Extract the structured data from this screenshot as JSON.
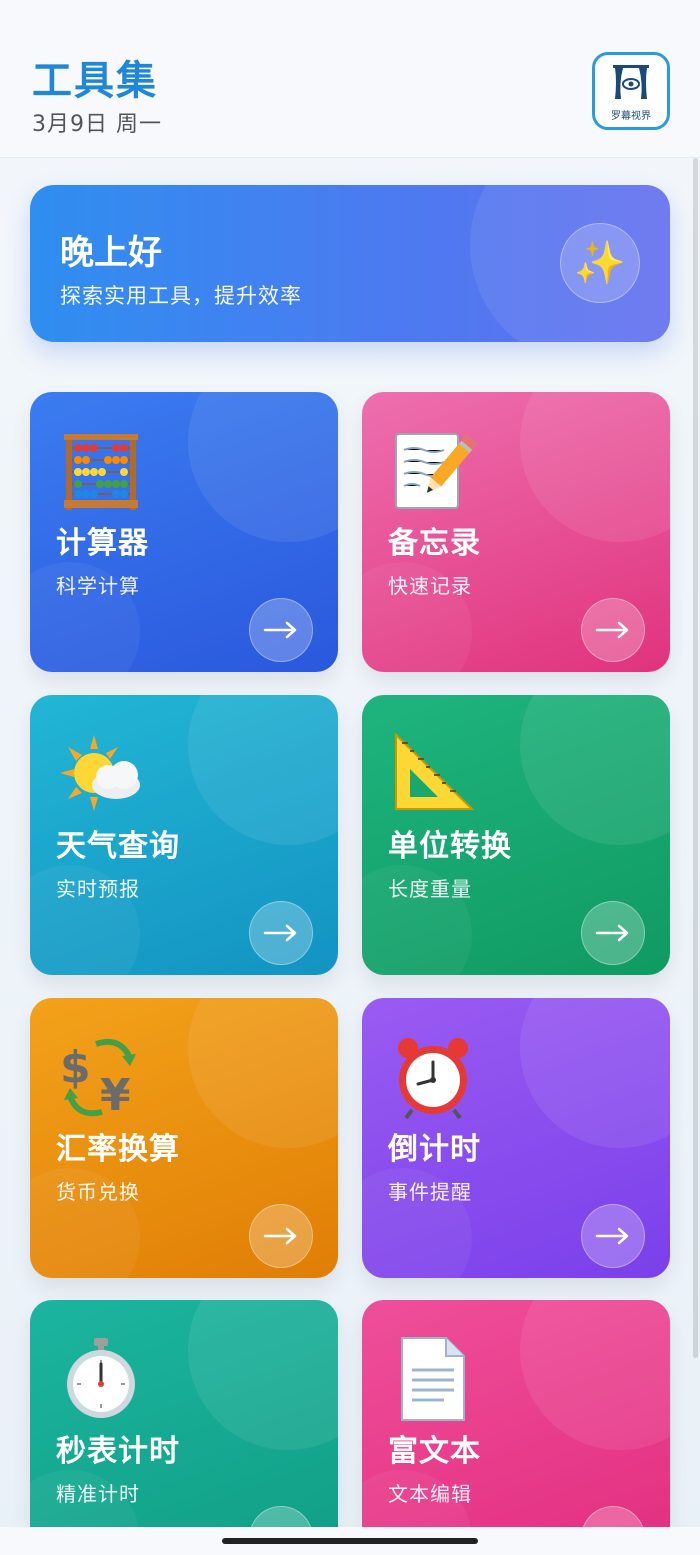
{
  "header": {
    "title": "工具集",
    "date": "3月9日 周一",
    "logo_text": "罗幕视界"
  },
  "greeting": {
    "title": "晚上好",
    "subtitle": "探索实用工具，提升效率",
    "icon": "sparkles-icon"
  },
  "tools": [
    {
      "title": "计算器",
      "subtitle": "科学计算",
      "icon": "abacus-icon",
      "color": "#2f6be6"
    },
    {
      "title": "备忘录",
      "subtitle": "快速记录",
      "icon": "memo-icon",
      "color": "#e64d92"
    },
    {
      "title": "天气查询",
      "subtitle": "实时预报",
      "icon": "sun-cloud-icon",
      "color": "#1aa6cc"
    },
    {
      "title": "单位转换",
      "subtitle": "长度重量",
      "icon": "triangle-ruler-icon",
      "color": "#16a86f"
    },
    {
      "title": "汇率换算",
      "subtitle": "货币兑换",
      "icon": "currency-exchange-icon",
      "color": "#ea8f10"
    },
    {
      "title": "倒计时",
      "subtitle": "事件提醒",
      "icon": "alarm-clock-icon",
      "color": "#8a4cee"
    },
    {
      "title": "秒表计时",
      "subtitle": "精准计时",
      "icon": "stopwatch-icon",
      "color": "#17aa92"
    },
    {
      "title": "富文本",
      "subtitle": "文本编辑",
      "icon": "document-icon",
      "color": "#e63d8b"
    }
  ]
}
